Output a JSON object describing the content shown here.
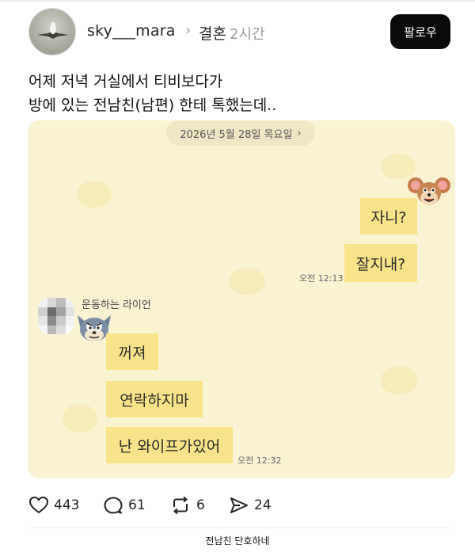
{
  "header": {
    "username": "sky___mara",
    "separator": "›",
    "category": "결혼",
    "time": "2시간",
    "follow_label": "팔로우"
  },
  "post": {
    "line1": "어제 저녁 거실에서 티비보다가",
    "line2": "방에 있는 전남친(남편) 한테 톡했는데.."
  },
  "chat": {
    "date": "2026년 5월 28일 목요일",
    "date_chevron": "›",
    "sent": [
      {
        "text": "자니?"
      },
      {
        "text": "잘지내?"
      }
    ],
    "sent_time": "오전 12:13",
    "sender_name": "운동하는 라이언",
    "received": [
      {
        "text": "꺼져"
      },
      {
        "text": "연락하지마"
      },
      {
        "text": "난 와이프가있어"
      }
    ],
    "received_time": "오전 12:32"
  },
  "actions": {
    "likes": "443",
    "comments": "61",
    "reposts": "6",
    "shares": "24"
  },
  "caption": "전남친 단호하네",
  "colors": {
    "chat_bg": "#faf3d2",
    "bubble": "#f9e38a",
    "follow_bg": "#0b0b0b"
  },
  "icons": [
    "heart-icon",
    "comment-icon",
    "repost-icon",
    "send-icon",
    "chevron-right-icon"
  ]
}
